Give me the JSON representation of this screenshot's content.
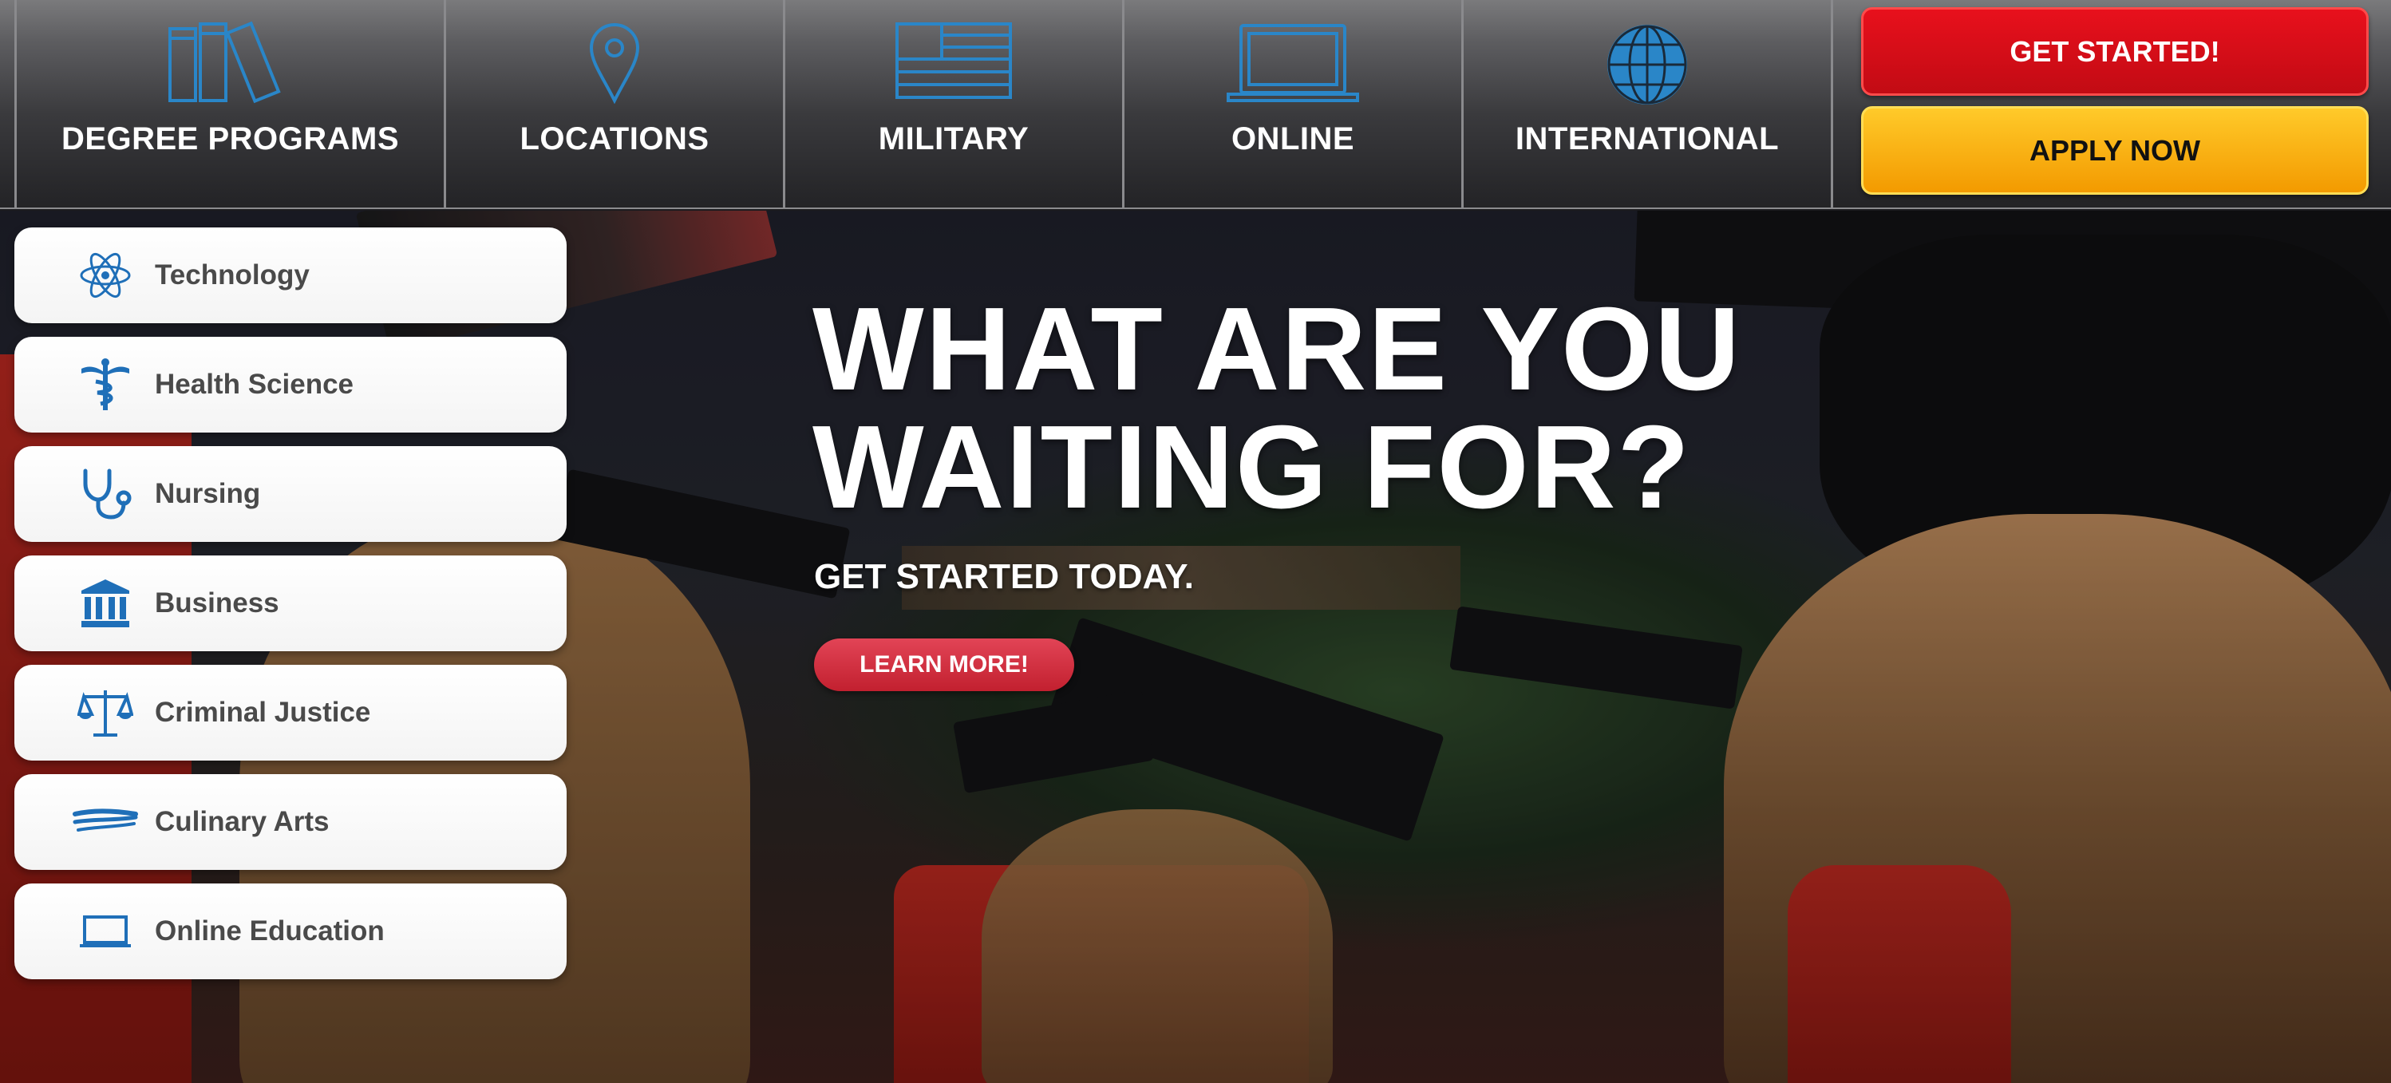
{
  "nav": {
    "items": [
      {
        "label": "DEGREE PROGRAMS",
        "icon": "books-icon"
      },
      {
        "label": "LOCATIONS",
        "icon": "map-pin-icon"
      },
      {
        "label": "MILITARY",
        "icon": "flag-icon"
      },
      {
        "label": "ONLINE",
        "icon": "laptop-icon"
      },
      {
        "label": "INTERNATIONAL",
        "icon": "globe-icon"
      }
    ],
    "get_started_label": "GET STARTED!",
    "apply_label": "APPLY NOW"
  },
  "hero": {
    "headline_line1": "WHAT ARE YOU",
    "headline_line2": "WAITING FOR?",
    "subheading": "GET STARTED TODAY.",
    "cta_label": "LEARN MORE!"
  },
  "programs": [
    {
      "label": "Technology",
      "icon": "atom-icon"
    },
    {
      "label": "Health Science",
      "icon": "caduceus-icon"
    },
    {
      "label": "Nursing",
      "icon": "stethoscope-icon"
    },
    {
      "label": "Business",
      "icon": "bank-icon"
    },
    {
      "label": "Criminal Justice",
      "icon": "scales-icon"
    },
    {
      "label": "Culinary Arts",
      "icon": "brush-strokes-icon"
    },
    {
      "label": "Online Education",
      "icon": "laptop-icon"
    }
  ],
  "colors": {
    "icon_blue": "#2a86c8",
    "program_icon_blue": "#1f6fb8",
    "get_started_red": "#e8101c",
    "apply_orange": "#f7a800",
    "learn_more_red": "#d8303f"
  }
}
